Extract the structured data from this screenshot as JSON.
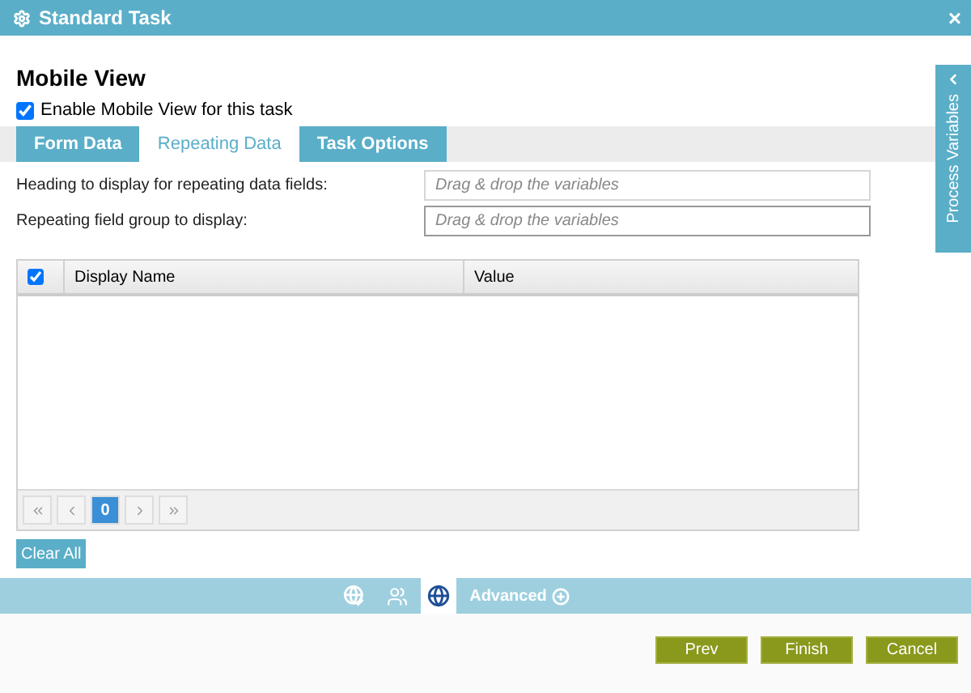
{
  "window": {
    "title": "Standard Task",
    "close": "×"
  },
  "heading": "Mobile View",
  "enable_mobile": {
    "label": "Enable Mobile View for this task",
    "checked": true
  },
  "tabs": [
    {
      "label": "Form Data",
      "selected": false
    },
    {
      "label": "Repeating Data",
      "selected": true
    },
    {
      "label": "Task Options",
      "selected": false
    }
  ],
  "fields": [
    {
      "label": "Heading to display for repeating data fields:",
      "placeholder": "Drag & drop the variables",
      "focused": false
    },
    {
      "label": "Repeating field group to display:",
      "placeholder": "Drag & drop the variables",
      "focused": true
    }
  ],
  "table": {
    "select_all_checked": true,
    "columns": [
      "Display Name",
      "Value"
    ],
    "pager": {
      "page": "0"
    }
  },
  "clear_button": "Clear All",
  "side_tab": "Process Variables",
  "bottom_bar": {
    "icons": [
      {
        "kind": "globe-pencil",
        "selected": false
      },
      {
        "kind": "users",
        "selected": false
      },
      {
        "kind": "globe",
        "selected": true
      }
    ],
    "advanced": "Advanced"
  },
  "buttons": [
    "Prev",
    "Finish",
    "Cancel"
  ]
}
